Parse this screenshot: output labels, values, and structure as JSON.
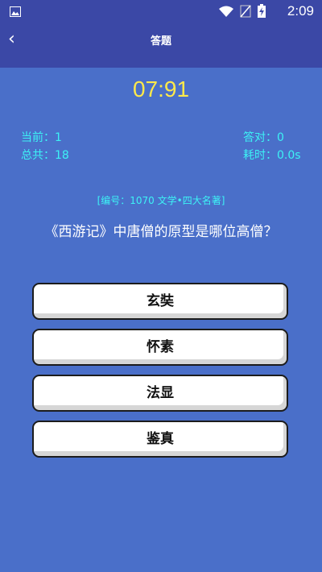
{
  "status_bar": {
    "time": "2:09",
    "icons": [
      "gallery-icon",
      "wifi-icon",
      "no-signal-icon",
      "battery-charging-icon"
    ]
  },
  "app_bar": {
    "back_label": "‹",
    "title": "答题"
  },
  "timer": "07:91",
  "stats": {
    "current": "当前：1",
    "total": "总共：18",
    "correct": "答对：0",
    "time_used": "耗时：0.0s"
  },
  "question_meta": "[编号：1070   文学•四大名著]",
  "question": "《西游记》中唐僧的原型是哪位高僧？",
  "options": [
    {
      "label": "玄奘"
    },
    {
      "label": "怀素"
    },
    {
      "label": "法显"
    },
    {
      "label": "鉴真"
    }
  ],
  "colors": {
    "background": "#4a6fc9",
    "app_bar": "#3b48a6",
    "timer": "#ffe94a",
    "stats": "#3df2f5"
  }
}
